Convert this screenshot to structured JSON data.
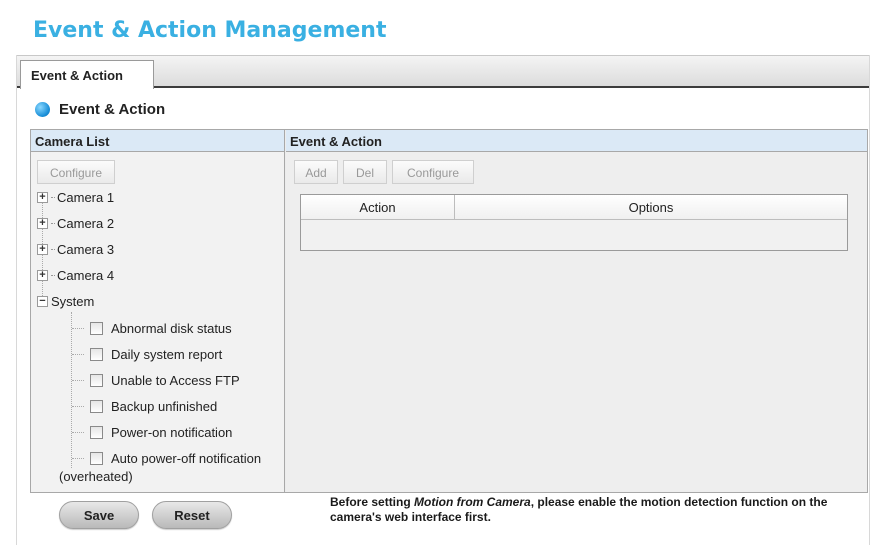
{
  "page": {
    "title": "Event & Action Management"
  },
  "tabs": [
    {
      "label": "Event & Action",
      "active": true
    }
  ],
  "section": {
    "title": "Event & Action",
    "icon": "blue-dot-icon"
  },
  "camera_list": {
    "header": "Camera List",
    "configure_label": "Configure",
    "nodes": [
      {
        "label": "Camera 1",
        "expanded": false
      },
      {
        "label": "Camera 2",
        "expanded": false
      },
      {
        "label": "Camera 3",
        "expanded": false
      },
      {
        "label": "Camera 4",
        "expanded": false
      },
      {
        "label": "System",
        "expanded": true
      }
    ],
    "system_items": [
      {
        "label": "Abnormal disk status",
        "checked": false
      },
      {
        "label": "Daily system report",
        "checked": false
      },
      {
        "label": "Unable to Access FTP",
        "checked": false
      },
      {
        "label": "Backup unfinished",
        "checked": false
      },
      {
        "label": "Power-on notification",
        "checked": false
      },
      {
        "label": "Auto power-off notification",
        "label_cont": "(overheated)",
        "checked": false
      }
    ]
  },
  "event_action": {
    "header": "Event & Action",
    "add_label": "Add",
    "del_label": "Del",
    "configure_label": "Configure",
    "columns": [
      "Action",
      "Options"
    ]
  },
  "footer": {
    "save_label": "Save",
    "reset_label": "Reset",
    "note_prefix": "Before setting ",
    "note_emphasis": "Motion from Camera",
    "note_suffix": ", please enable the motion detection function on the camera's web interface first."
  },
  "colors": {
    "title": "#3ab0e2",
    "header_bg": "#dbe9f6"
  }
}
